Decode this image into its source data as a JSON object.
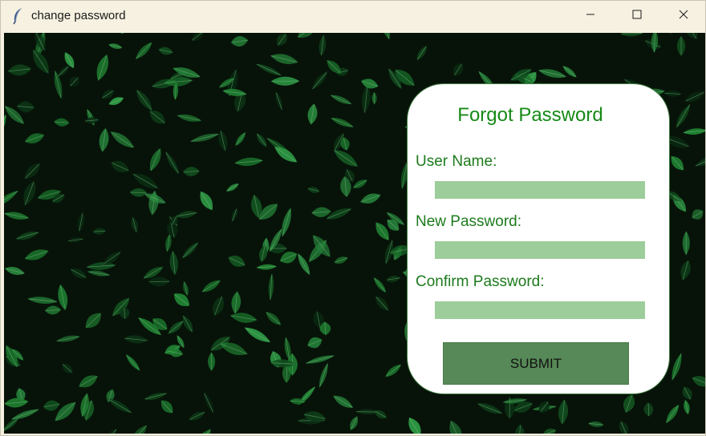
{
  "window": {
    "title": "change password",
    "icon": "feather-icon"
  },
  "controls": {
    "minimize": "minimize-icon",
    "maximize": "maximize-icon",
    "close": "close-icon"
  },
  "form": {
    "title": "Forgot Password",
    "fields": [
      {
        "label": "User Name:",
        "value": ""
      },
      {
        "label": "New Password:",
        "value": ""
      },
      {
        "label": "Confirm Password:",
        "value": ""
      }
    ],
    "submit_label": "SUBMIT"
  },
  "colors": {
    "title_green": "#168a16",
    "label_green": "#1d7b1d",
    "input_fill": "#9ccd9a",
    "button_fill": "#578857",
    "background_foliage": "#0f3a18"
  }
}
